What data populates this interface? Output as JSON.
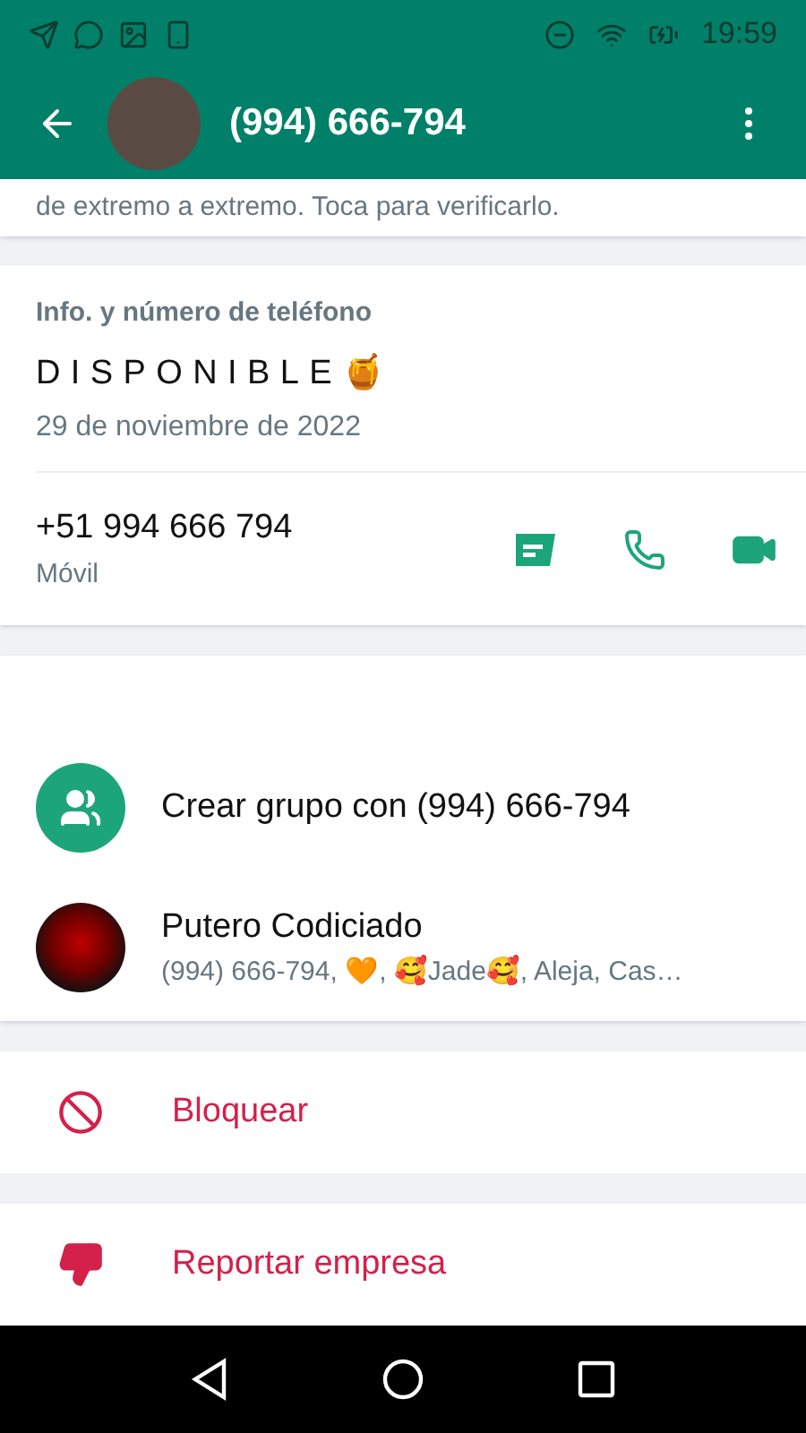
{
  "status_bar": {
    "time": "19:59"
  },
  "header": {
    "title": "(994) 666-794"
  },
  "encryption_note": "de extremo a extremo. Toca para verificarlo.",
  "info": {
    "heading": "Info. y número de teléfono",
    "about": "DISPONIBLE🍯",
    "about_date": "29 de noviembre de 2022",
    "phone": "+51 994 666 794",
    "phone_type": "Móvil"
  },
  "groups": [
    {
      "kind": "create",
      "title": "Crear grupo con (994) 666-794"
    },
    {
      "kind": "group",
      "title": "Putero Codiciado",
      "subtitle": "(994) 666-794, 🧡, 🥰Jade🥰, Aleja, Cas…"
    }
  ],
  "actions": [
    {
      "kind": "block",
      "label": "Bloquear"
    },
    {
      "kind": "report",
      "label": "Reportar empresa"
    }
  ]
}
